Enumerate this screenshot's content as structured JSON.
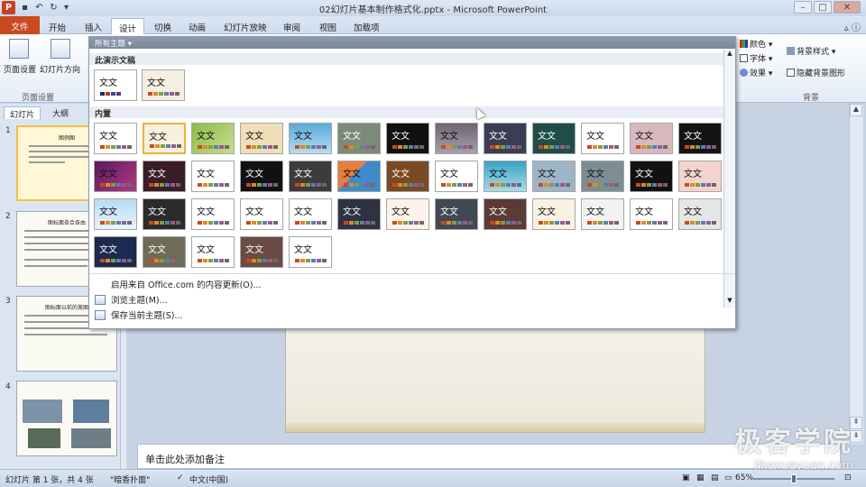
{
  "window": {
    "title": "02幻灯片基本制作格式化.pptx - Microsoft PowerPoint",
    "controls": [
      "–",
      "□",
      "✕"
    ]
  },
  "tabs": {
    "file": "文件",
    "items": [
      "开始",
      "插入",
      "设计",
      "切换",
      "动画",
      "幻灯片放映",
      "审阅",
      "视图",
      "加载项"
    ],
    "active": "设计"
  },
  "ribbon": {
    "page_setup": "页面设置",
    "slide_orientation": "幻灯片方向",
    "group_page_setup": "页面设置",
    "colors": "颜色",
    "fonts": "字体",
    "effects": "效果",
    "background_styles": "背景样式",
    "hide_background": "隐藏背景图形",
    "group_background": "背景"
  },
  "left_panel": {
    "tab_slides": "幻灯片",
    "tab_outline": "大纲",
    "slides": [
      {
        "num": "1",
        "title": "图例图"
      },
      {
        "num": "2",
        "title": "图标面各合各由"
      },
      {
        "num": "3",
        "title": "图标面以前的美图"
      },
      {
        "num": "4",
        "title": ""
      }
    ]
  },
  "gallery": {
    "header": "所有主题",
    "section_this": "此演示文稿",
    "section_builtin": "内置",
    "tile_text": "文文",
    "commands": [
      "启用来自 Office.com 的内容更新(O)...",
      "浏览主题(M)...",
      "保存当前主题(S)..."
    ]
  },
  "notes_placeholder": "单击此处添加备注",
  "status": {
    "slide_info": "幻灯片 第 1 张，共 4 张",
    "theme": "\"暗香扑面\"",
    "language": "中文(中国)",
    "zoom": "65%",
    "zoom_level": 0.65
  },
  "watermark": {
    "line1": "极客学院",
    "line2": "jikexueyuan.com"
  },
  "theme_colors": {
    "accent": "#c94a1f",
    "selection": "#f0b13a",
    "ribbon_bg": "#dbe6f4"
  }
}
